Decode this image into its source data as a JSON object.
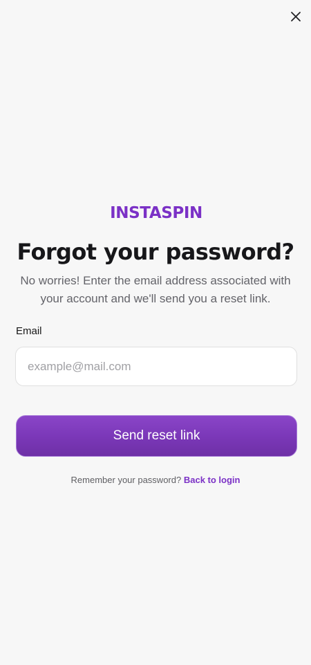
{
  "header": {
    "close_icon": "close-icon"
  },
  "logo": {
    "text": "INSTASPIN",
    "color": "#7b31c6"
  },
  "page": {
    "title": "Forgot your password?",
    "subtitle": "No worries! Enter the email address associated with your account and we'll send you a reset link."
  },
  "form": {
    "email_label": "Email",
    "email_value": "",
    "email_placeholder": "example@mail.com",
    "submit_label": "Send reset link"
  },
  "footer": {
    "prompt": "Remember your password?",
    "link_label": "Back to login"
  },
  "colors": {
    "accent": "#7b31c6",
    "background": "#f7f7f7"
  }
}
